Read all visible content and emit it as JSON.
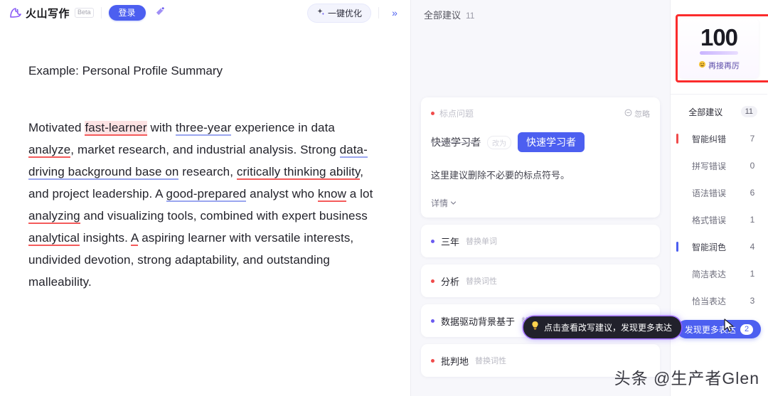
{
  "topbar": {
    "brand_name": "火山写作",
    "beta_label": "Beta",
    "login_label": "登录",
    "wand_icon": "magic-wand-icon",
    "optimize_label": "一键优化",
    "optimize_icon": "sparkle-icon",
    "collapse_icon": "double-chevron-right-icon"
  },
  "document": {
    "title": "Example: Personal Profile Summary",
    "paragraph": [
      {
        "t": "Motivated ",
        "mark": "none"
      },
      {
        "t": "fast-learner",
        "mark": "red-hl"
      },
      {
        "t": " with ",
        "mark": "none"
      },
      {
        "t": "three-year",
        "mark": "blue"
      },
      {
        "t": " experience in data ",
        "mark": "none"
      },
      {
        "t": "analyze",
        "mark": "red"
      },
      {
        "t": ", market research, and industrial analysis. Strong ",
        "mark": "none"
      },
      {
        "t": "data-driving background base on",
        "mark": "blue"
      },
      {
        "t": " research, ",
        "mark": "none"
      },
      {
        "t": "critically thinking ability",
        "mark": "red"
      },
      {
        "t": ", and project leadership. A ",
        "mark": "none"
      },
      {
        "t": "good-prepared",
        "mark": "blue"
      },
      {
        "t": " analyst who ",
        "mark": "none"
      },
      {
        "t": "know",
        "mark": "red"
      },
      {
        "t": " a lot ",
        "mark": "none"
      },
      {
        "t": "analyzing",
        "mark": "red"
      },
      {
        "t": " and visualizing tools, combined with expert business ",
        "mark": "none"
      },
      {
        "t": "analytical",
        "mark": "red"
      },
      {
        "t": " insights. ",
        "mark": "none"
      },
      {
        "t": "A",
        "mark": "red"
      },
      {
        "t": " aspiring learner with versatile interests, undivided devotion, strong adaptability, and outstanding malleability.",
        "mark": "none"
      }
    ]
  },
  "suggestions": {
    "header_label": "全部建议",
    "header_count": "11",
    "open_card": {
      "tag_label": "标点问题",
      "tag_dot_color": "#f04b4b",
      "ignore_label": "忽略",
      "ignore_icon": "circle-minus-icon",
      "original_text": "快速学习者",
      "change_to_label": "改为",
      "replacement_text": "快速学习者",
      "description": "这里建议删除不必要的标点符号。",
      "details_label": "详情",
      "details_icon": "chevron-down-icon"
    },
    "items": [
      {
        "word": "三年",
        "type": "替换单词",
        "dot": "purple"
      },
      {
        "word": "分析",
        "type": "替换词性",
        "dot": "red"
      },
      {
        "word": "数据驱动背景基于",
        "type": "替换单词",
        "dot": "purple"
      },
      {
        "word": "批判地",
        "type": "替换词性",
        "dot": "red"
      }
    ],
    "tooltip": {
      "icon": "lightbulb-icon",
      "text": "点击查看改写建议，发现更多表达"
    }
  },
  "sidebar": {
    "score": {
      "value": "100",
      "sub_icon": "smiley-icon",
      "sub_label": "再接再厉"
    },
    "nav": [
      {
        "label": "全部建议",
        "count": "11",
        "style": "head",
        "bar": "none"
      },
      {
        "label": "智能纠错",
        "count": "7",
        "style": "group",
        "bar": "red"
      },
      {
        "label": "拼写错误",
        "count": "0",
        "style": "sub",
        "bar": "none"
      },
      {
        "label": "语法错误",
        "count": "6",
        "style": "sub",
        "bar": "none"
      },
      {
        "label": "格式错误",
        "count": "1",
        "style": "sub",
        "bar": "none"
      },
      {
        "label": "智能润色",
        "count": "4",
        "style": "group",
        "bar": "purple"
      },
      {
        "label": "简洁表达",
        "count": "1",
        "style": "sub",
        "bar": "none"
      },
      {
        "label": "恰当表达",
        "count": "3",
        "style": "sub",
        "bar": "none"
      }
    ],
    "more_button": {
      "label": "发现更多表达",
      "badge": "2"
    }
  },
  "watermark": "头条 @生产者Glen",
  "colors": {
    "accent": "#4c5ff0",
    "error": "#f04b4b",
    "polish": "#6b5bf0",
    "annotation_box": "#fb2c2c"
  }
}
